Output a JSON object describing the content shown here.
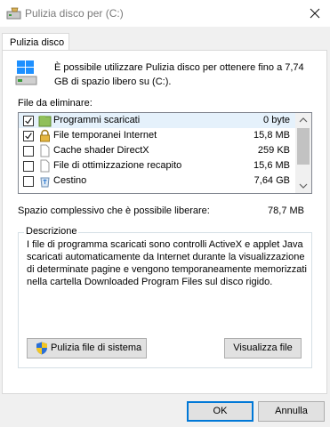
{
  "window": {
    "title": "Pulizia disco per  (C:)",
    "icon": "disk-cleanup-icon"
  },
  "tabs": [
    {
      "label": "Pulizia disco",
      "selected": true
    }
  ],
  "intro": {
    "text": "È possibile utilizzare Pulizia disco per ottenere fino a 7,74 GB di spazio libero su  (C:).",
    "icon": "drive-icon"
  },
  "files": {
    "label": "File da eliminare:",
    "items": [
      {
        "name": "Programmi scaricati",
        "size": "0 byte",
        "checked": true,
        "icon": "folder-green-icon",
        "selected": true
      },
      {
        "name": "File temporanei Internet",
        "size": "15,8 MB",
        "checked": true,
        "icon": "lock-icon",
        "selected": false
      },
      {
        "name": "Cache shader DirectX",
        "size": "259 KB",
        "checked": false,
        "icon": "blank-file-icon",
        "selected": false
      },
      {
        "name": "File di ottimizzazione recapito",
        "size": "15,6 MB",
        "checked": false,
        "icon": "blank-file-icon",
        "selected": false
      },
      {
        "name": "Cestino",
        "size": "7,64 GB",
        "checked": false,
        "icon": "recycle-bin-icon",
        "selected": false
      }
    ]
  },
  "total": {
    "label": "Spazio complessivo che è possibile liberare:",
    "value": "78,7 MB"
  },
  "description": {
    "title": "Descrizione",
    "text": "I file di programma scaricati sono controlli ActiveX e applet Java scaricati automaticamente da Internet durante la visualizzazione di determinate pagine e vengono temporaneamente memorizzati nella cartella Downloaded Program Files sul disco rigido."
  },
  "buttons": {
    "system_cleanup": "Pulizia file di sistema",
    "view_files": "Visualizza file",
    "ok": "OK",
    "cancel": "Annulla"
  },
  "colors": {
    "accent": "#0078d7",
    "selection": "#e5f1fb",
    "panel": "#ffffff",
    "chrome": "#f0f0f0"
  }
}
